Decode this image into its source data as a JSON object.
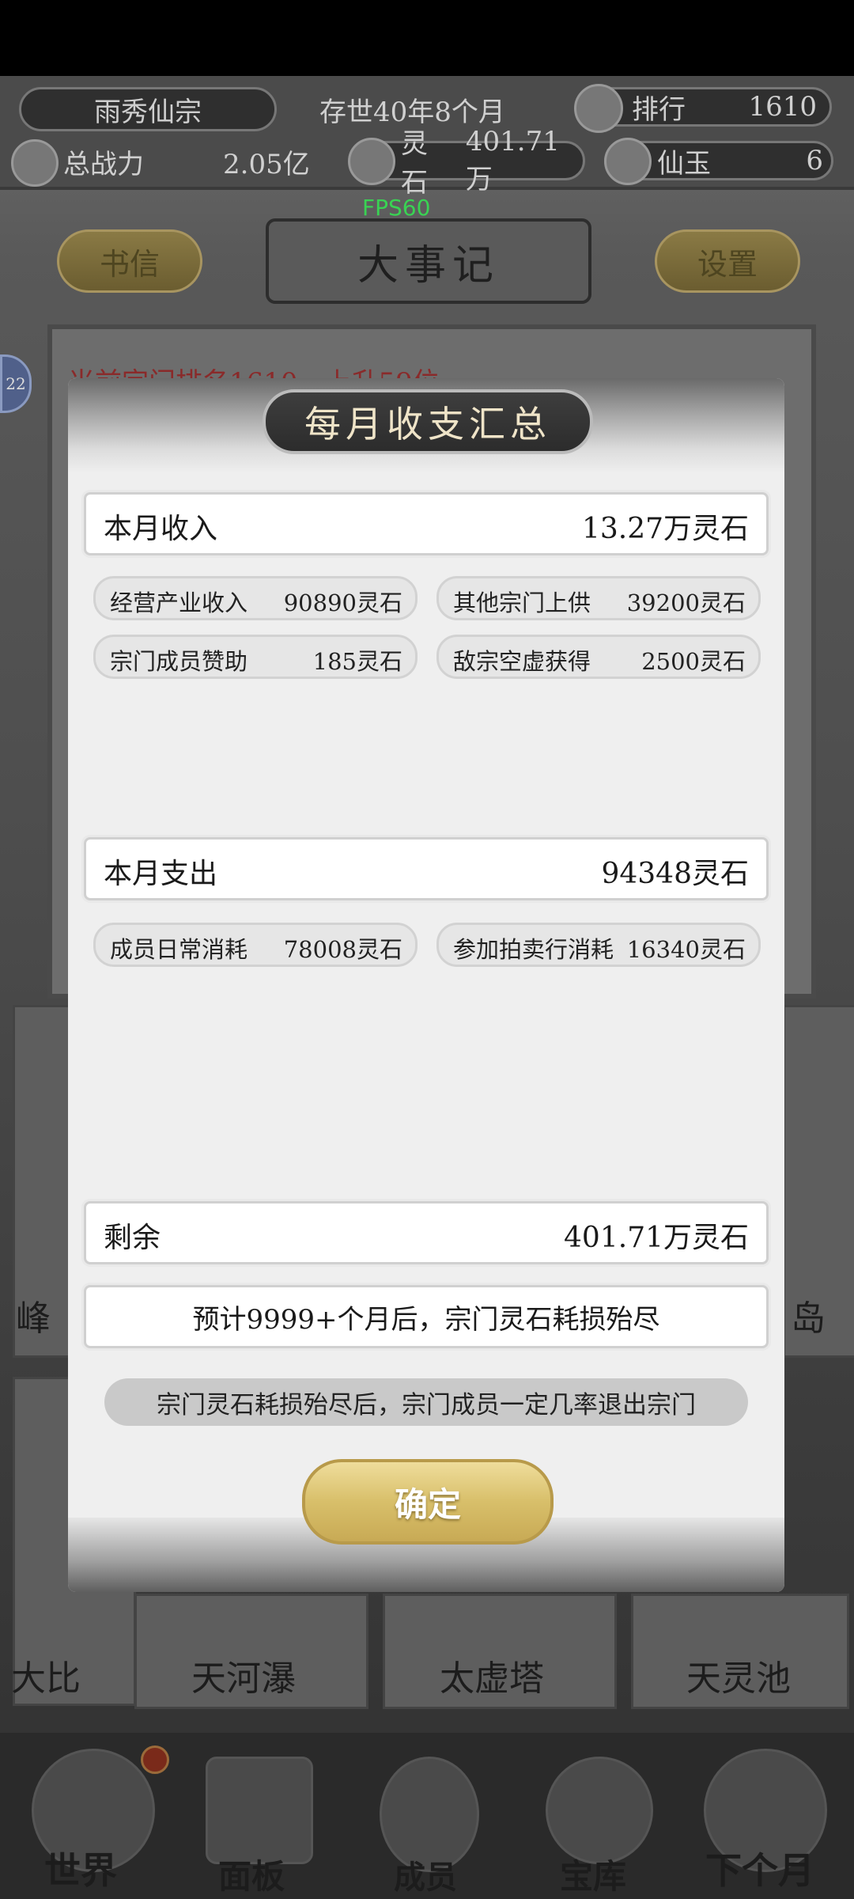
{
  "topbar": {
    "sect_name": "雨秀仙宗",
    "age": "存世40年8个月",
    "rank_label": "排行",
    "rank_value": "1610",
    "power_label": "总战力",
    "power_value": "2.05亿",
    "stones_label": "灵石",
    "stones_value": "401.71万",
    "jade_label": "仙玉",
    "jade_value": "6"
  },
  "fps": "FPS60",
  "nav": {
    "letters_label": "书信",
    "events_label": "大事记",
    "settings_label": "设置"
  },
  "background": {
    "rank_notice": "当前宗门排名1610，上升59位",
    "badge": "22",
    "places": [
      "大比",
      "天河瀑",
      "太虚塔",
      "天灵池"
    ],
    "side_labels": [
      "峰",
      "岛"
    ]
  },
  "bottom_nav": [
    "世界",
    "面板",
    "成员",
    "宝库",
    "下个月"
  ],
  "modal": {
    "title": "每月收支汇总",
    "income": {
      "label": "本月收入",
      "total": "13.27万灵石"
    },
    "income_items": [
      {
        "label": "经营产业收入",
        "value": "90890灵石"
      },
      {
        "label": "其他宗门上供",
        "value": "39200灵石"
      },
      {
        "label": "宗门成员赞助",
        "value": "185灵石"
      },
      {
        "label": "敌宗空虚获得",
        "value": "2500灵石"
      }
    ],
    "expense": {
      "label": "本月支出",
      "total": "94348灵石"
    },
    "expense_items": [
      {
        "label": "成员日常消耗",
        "value": "78008灵石"
      },
      {
        "label": "参加拍卖行消耗",
        "value": "16340灵石"
      }
    ],
    "remaining": {
      "label": "剩余",
      "total": "401.71万灵石"
    },
    "forecast": "预计9999+个月后，宗门灵石耗损殆尽",
    "warning": "宗门灵石耗损殆尽后，宗门成员一定几率退出宗门",
    "confirm_label": "确定"
  }
}
